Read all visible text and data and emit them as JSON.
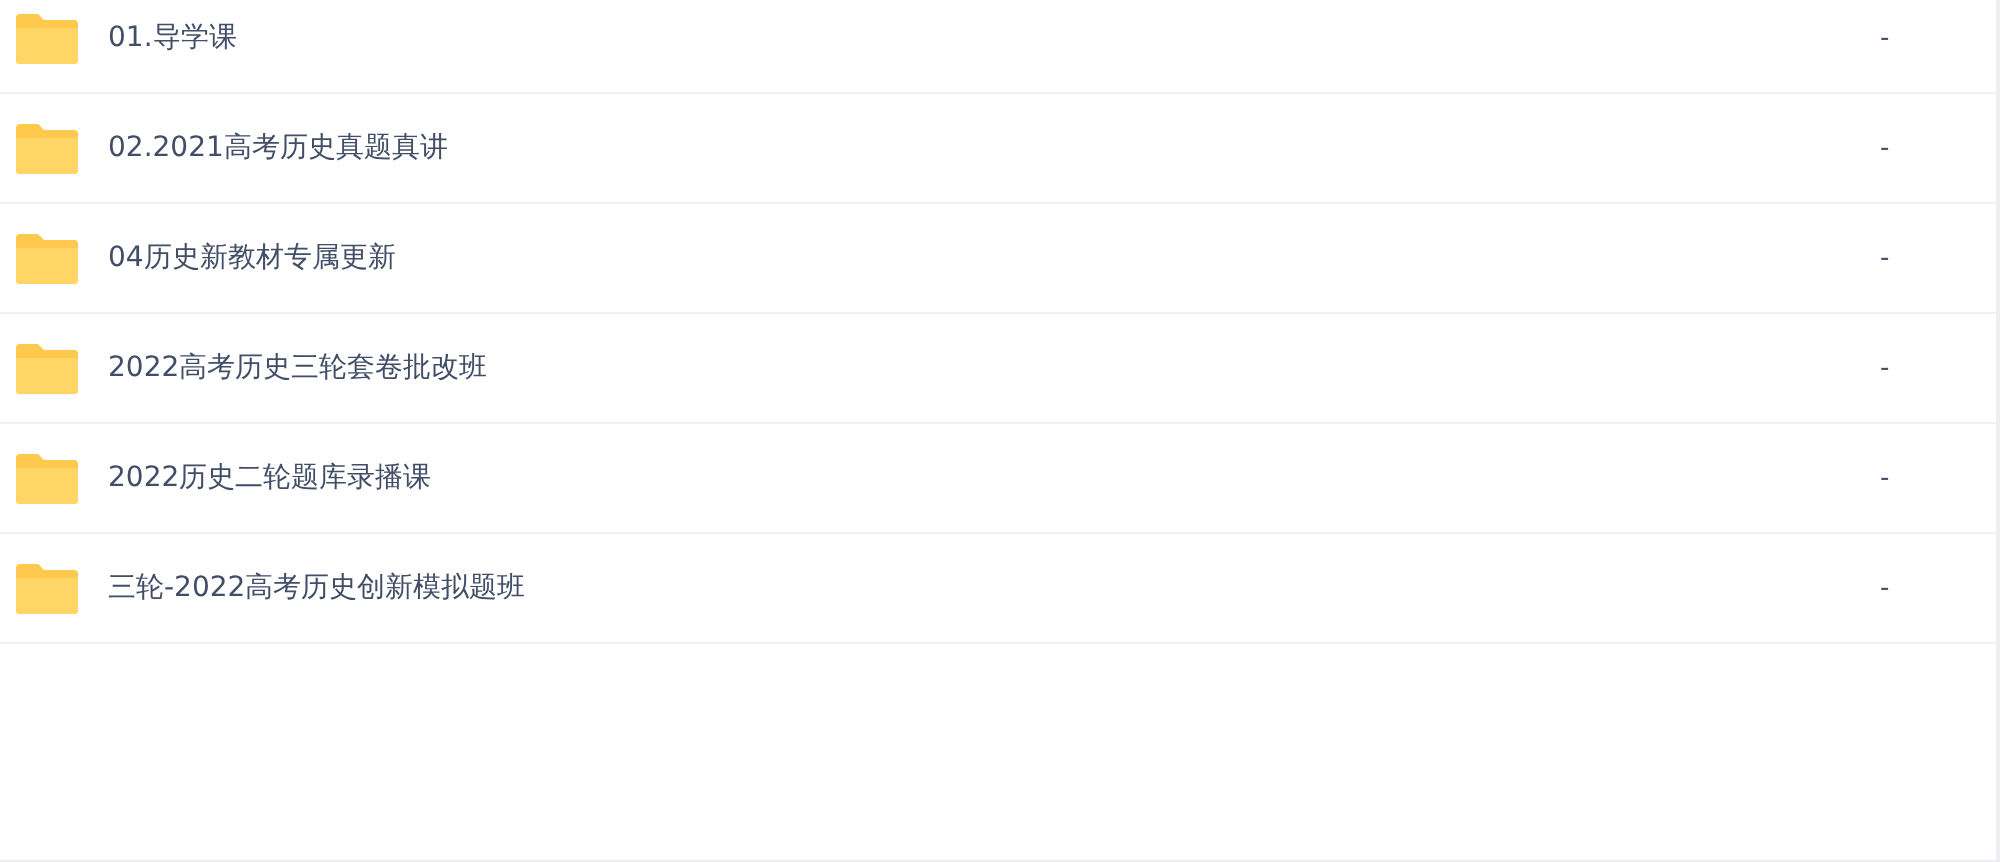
{
  "files": [
    {
      "name": "01.导学课",
      "size": "-"
    },
    {
      "name": "02.2021高考历史真题真讲",
      "size": "-"
    },
    {
      "name": "04历史新教材专属更新",
      "size": "-"
    },
    {
      "name": "2022高考历史三轮套卷批改班",
      "size": "-"
    },
    {
      "name": "2022历史二轮题库录播课",
      "size": "-"
    },
    {
      "name": "三轮-2022高考历史创新模拟题班",
      "size": "-"
    }
  ]
}
